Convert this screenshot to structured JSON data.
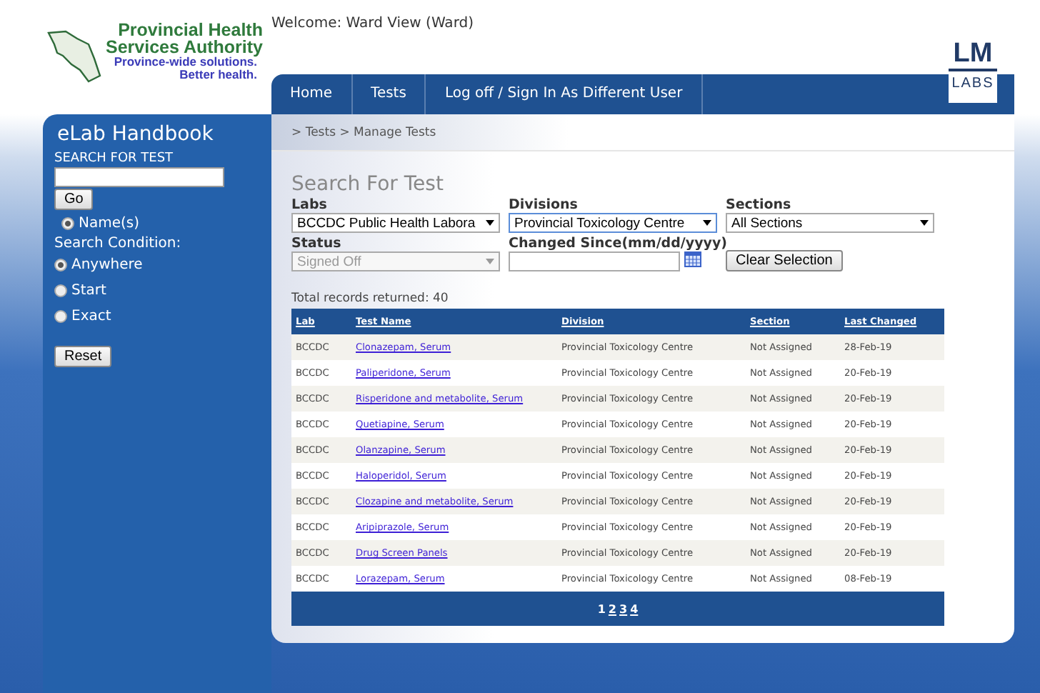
{
  "header": {
    "org_logo": {
      "lines": [
        "Provincial Health",
        "Services Authority"
      ],
      "tagline": [
        "Province-wide solutions.",
        "Better health."
      ]
    },
    "welcome": "Welcome: Ward View (Ward)",
    "brand_logo": {
      "top": "LM",
      "bottom": "LABS"
    }
  },
  "nav": [
    {
      "label": "Home"
    },
    {
      "label": "Tests"
    },
    {
      "label": "Log off / Sign In As Different User"
    }
  ],
  "sidebar": {
    "title": "eLab Handbook",
    "search_label": "SEARCH FOR TEST",
    "go_button": "Go",
    "name_option": {
      "label": "Name(s)",
      "selected": true
    },
    "condition_label": "Search Condition:",
    "conditions": [
      {
        "label": "Anywhere",
        "selected": true
      },
      {
        "label": "Start",
        "selected": false
      },
      {
        "label": "Exact",
        "selected": false
      }
    ],
    "reset_button": "Reset"
  },
  "breadcrumb": "> Tests > Manage Tests",
  "search": {
    "title": "Search For Test",
    "filters": [
      {
        "kind": "select",
        "label": "Labs",
        "value": "BCCDC Public Health Labora",
        "disabled": false,
        "focused": false
      },
      {
        "kind": "select",
        "label": "Divisions",
        "value": "Provincial Toxicology Centre",
        "disabled": false,
        "focused": true
      },
      {
        "kind": "select",
        "label": "Sections",
        "value": "All Sections",
        "disabled": false,
        "focused": false
      },
      {
        "kind": "select",
        "label": "Status",
        "value": "Signed Off",
        "disabled": true,
        "focused": false
      },
      {
        "kind": "date",
        "label": "Changed Since(mm/dd/yyyy)"
      },
      {
        "kind": "button",
        "value": "Clear Selection"
      }
    ]
  },
  "total": "Total records returned: 40",
  "table": {
    "columns": [
      "Lab",
      "Test Name",
      "Division",
      "Section",
      "Last Changed"
    ],
    "rows": [
      [
        "BCCDC",
        "Clonazepam, Serum",
        "Provincial Toxicology Centre",
        "Not Assigned",
        "28-Feb-19"
      ],
      [
        "BCCDC",
        "Paliperidone, Serum",
        "Provincial Toxicology Centre",
        "Not Assigned",
        "20-Feb-19"
      ],
      [
        "BCCDC",
        "Risperidone and metabolite, Serum",
        "Provincial Toxicology Centre",
        "Not Assigned",
        "20-Feb-19"
      ],
      [
        "BCCDC",
        "Quetiapine, Serum",
        "Provincial Toxicology Centre",
        "Not Assigned",
        "20-Feb-19"
      ],
      [
        "BCCDC",
        "Olanzapine, Serum",
        "Provincial Toxicology Centre",
        "Not Assigned",
        "20-Feb-19"
      ],
      [
        "BCCDC",
        "Haloperidol, Serum",
        "Provincial Toxicology Centre",
        "Not Assigned",
        "20-Feb-19"
      ],
      [
        "BCCDC",
        "Clozapine and metabolite, Serum",
        "Provincial Toxicology Centre",
        "Not Assigned",
        "20-Feb-19"
      ],
      [
        "BCCDC",
        "Aripiprazole, Serum",
        "Provincial Toxicology Centre",
        "Not Assigned",
        "20-Feb-19"
      ],
      [
        "BCCDC",
        "Drug Screen Panels",
        "Provincial Toxicology Centre",
        "Not Assigned",
        "20-Feb-19"
      ],
      [
        "BCCDC",
        "Lorazepam, Serum",
        "Provincial Toxicology Centre",
        "Not Assigned",
        "08-Feb-19"
      ]
    ],
    "pages": [
      {
        "label": "1",
        "selected": true
      },
      {
        "label": "2",
        "selected": false
      },
      {
        "label": "3",
        "selected": false
      },
      {
        "label": "4",
        "selected": false
      }
    ]
  }
}
